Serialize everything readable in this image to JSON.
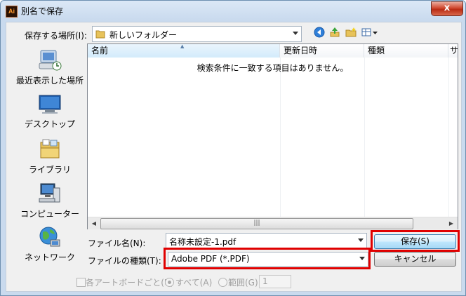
{
  "window": {
    "app_icon_text": "Ai",
    "title": "別名で保存",
    "close_symbol": "x"
  },
  "location": {
    "label": "保存する場所(I):",
    "current_folder": "新しいフォルダー",
    "folder_icon": "folder-icon"
  },
  "toolbar": {
    "icons": [
      "back-icon",
      "up-folder-icon",
      "new-folder-icon",
      "view-menu-icon"
    ]
  },
  "places": [
    {
      "label": "最近表示した場所",
      "icon": "recent-places-icon"
    },
    {
      "label": "デスクトップ",
      "icon": "desktop-icon"
    },
    {
      "label": "ライブラリ",
      "icon": "libraries-icon"
    },
    {
      "label": "コンピューター",
      "icon": "computer-icon"
    },
    {
      "label": "ネットワーク",
      "icon": "network-icon"
    }
  ],
  "file_list": {
    "columns": [
      "名前",
      "更新日時",
      "種類",
      "サ"
    ],
    "empty_message": "検索条件に一致する項目はありません。",
    "sort_indicator": "▲",
    "scroll_grip": "|||"
  },
  "filename": {
    "label": "ファイル名(N):",
    "value": "名称未設定-1.pdf"
  },
  "filetype": {
    "label": "ファイルの種類(T):",
    "value": "Adobe PDF (*.PDF)"
  },
  "buttons": {
    "save": "保存(S)",
    "cancel": "キャンセル"
  },
  "options": {
    "each_artboard": "各アートボードごと(U)",
    "all": "すべて(A)",
    "range": "範囲(G):",
    "range_value": "1"
  },
  "colors": {
    "highlight": "#e00000",
    "default_button": "#bee6fd"
  }
}
